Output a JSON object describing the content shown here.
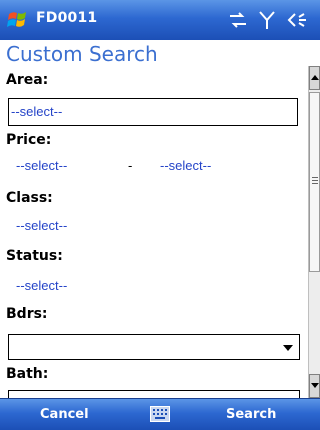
{
  "window": {
    "title": "FD0011"
  },
  "status_icons": [
    "connectivity-icon",
    "signal-icon",
    "volume-icon"
  ],
  "page": {
    "title": "Custom Search"
  },
  "form": {
    "area": {
      "label": "Area:",
      "value": "--select--"
    },
    "price": {
      "label": "Price:",
      "min": "--select--",
      "separator": "-",
      "max": "--select--"
    },
    "class": {
      "label": "Class:",
      "value": "--select--"
    },
    "status": {
      "label": "Status:",
      "value": "--select--"
    },
    "bdrs": {
      "label": "Bdrs:",
      "value": ""
    },
    "bath": {
      "label": "Bath:",
      "value": ""
    }
  },
  "menubar": {
    "left": "Cancel",
    "right": "Search",
    "center_icon": "keyboard-icon"
  },
  "colors": {
    "accent": "#2d68d1",
    "link": "#2544c8",
    "title": "#3b6fd0"
  }
}
